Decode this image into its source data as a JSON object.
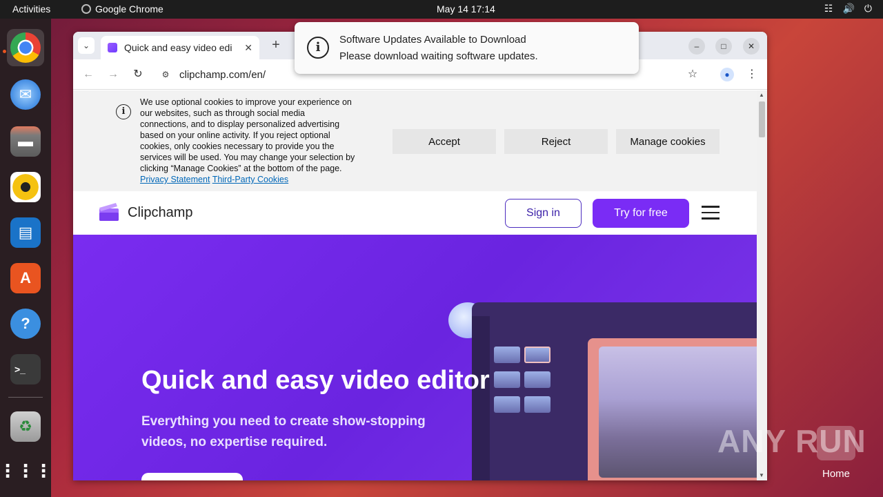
{
  "topbar": {
    "activities": "Activities",
    "app_name": "Google Chrome",
    "clock": "May 14  17:14"
  },
  "dock": {
    "items": [
      "chrome",
      "thunderbird",
      "files",
      "rhythmbox",
      "writer",
      "app-center",
      "help",
      "terminal",
      "trash",
      "show-apps"
    ]
  },
  "browser": {
    "tab_title": "Quick and easy video edi",
    "url": "clipchamp.com/en/"
  },
  "notification": {
    "title": "Software Updates Available to Download",
    "body": "Please download waiting software updates."
  },
  "cookie_banner": {
    "text": "We use optional cookies to improve your experience on our websites, such as through social media connections, and to display personalized advertising based on your online activity. If you reject optional cookies, only cookies necessary to provide you the services will be used. You may change your selection by clicking “Manage Cookies” at the bottom of the page.",
    "privacy_link": "Privacy Statement",
    "third_party_link": "Third-Party Cookies",
    "accept_label": "Accept",
    "reject_label": "Reject",
    "manage_label": "Manage cookies"
  },
  "site_header": {
    "logo_text": "Clipchamp",
    "signin_label": "Sign in",
    "try_label": "Try for free"
  },
  "hero": {
    "headline": "Quick and easy video editor",
    "subline": "Everything you need to create show-stopping videos, no expertise required."
  },
  "desktop": {
    "watermark": "ANY RUN",
    "home_label": "Home"
  },
  "colors": {
    "accent": "#7a2cf5",
    "ubuntu_orange": "#e95420"
  }
}
